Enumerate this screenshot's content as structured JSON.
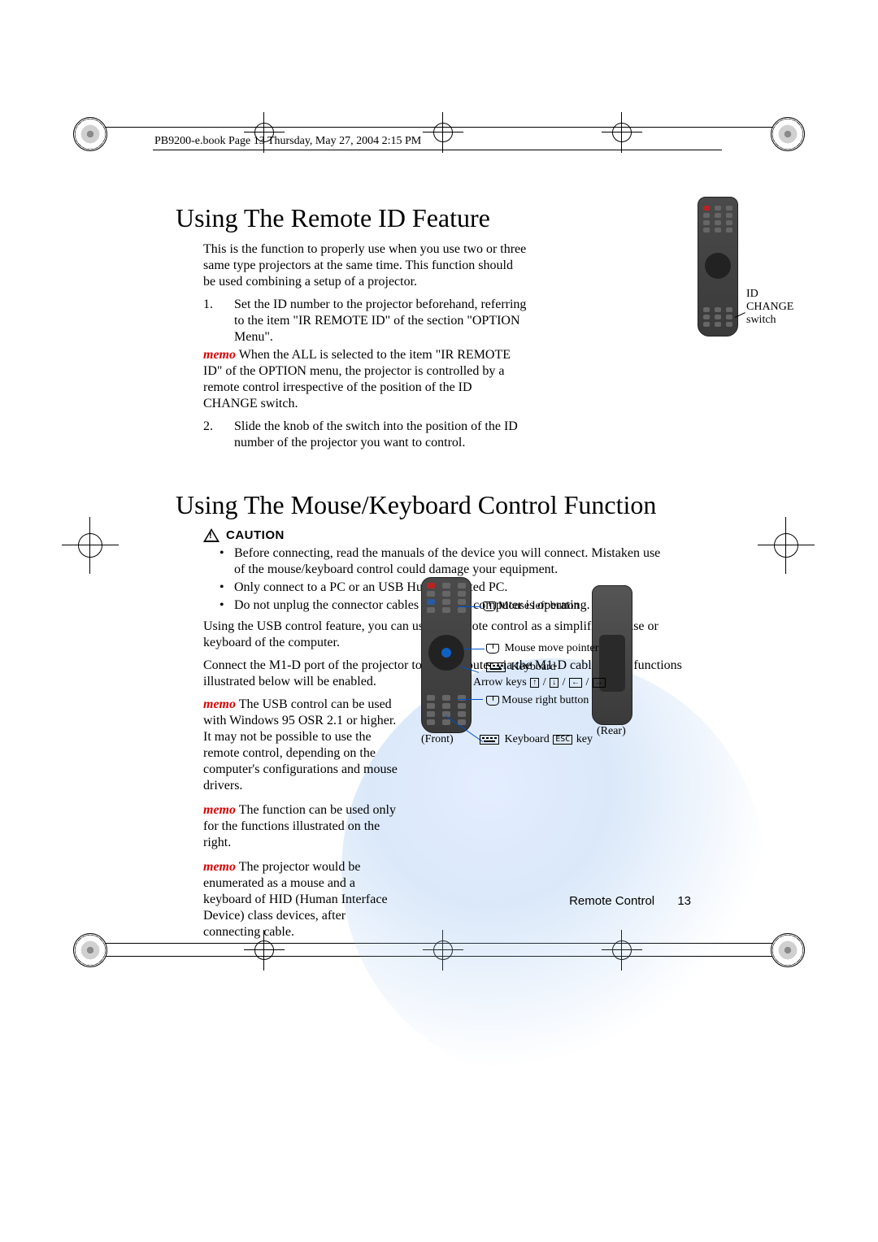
{
  "meta": {
    "bookinfo": "PB9200-e.book  Page 13  Thursday, May 27, 2004  2:15 PM"
  },
  "section1": {
    "title": "Using The Remote ID Feature",
    "intro": "This is the function to properly use when you use two or three same type projectors at the same time. This function should be used combining a setup of a projector.",
    "step1_num": "1.",
    "step1": "Set the ID number to the projector beforehand, referring to the item \"IR REMOTE ID\" of the section \"OPTION Menu\".",
    "memo1_label": "memo",
    "memo1": " When the ALL is selected to the item \"IR REMOTE ID\" of the OPTION menu, the projector is controlled by a remote control irrespective of the position of the ID CHANGE switch.",
    "step2_num": "2.",
    "step2": "Slide the knob of the switch into the position of the ID number of the projector you want to control.",
    "id_label_l1": "ID",
    "id_label_l2": "CHANGE",
    "id_label_l3": "switch"
  },
  "section2": {
    "title": "Using The Mouse/Keyboard Control Function",
    "caution": "CAUTION",
    "bul1": "Before connecting, read the manuals of the device you will connect. Mistaken use of the mouse/keyboard control could damage your equipment.",
    "bul2": "Only connect to a PC or an USB Hub connected PC.",
    "bul3": "Do not unplug the connector cables while the computer is operating.",
    "p1": "Using the USB control feature, you can use the remote control as a simplified mouse or keyboard of the computer.",
    "p2": "Connect the M1-D port of the projector to the computer via the M1-D cable. Then functions illustrated below will be enabled.",
    "memoA_label": "memo",
    "memoA": " The USB control can be used with Windows 95 OSR 2.1 or higher. It may not be possible to use the remote control, depending on the computer's configurations and mouse drivers.",
    "memoB_label": "memo",
    "memoB": " The function can be used only for the functions illustrated on the right.",
    "memoC_label": "memo",
    "memoC": " The projector would be enumerated as a mouse and a keyboard of HID (Human Interface Device) class devices, after connecting cable."
  },
  "diagram": {
    "front": "(Front)",
    "rear": "(Rear)",
    "mouse_left": "Mouse left button",
    "mouse_move": "Mouse move pointer",
    "keyboard": "Keyboard",
    "arrow_keys": "Arrow keys",
    "mouse_right": "Mouse right button",
    "kb_esc1": "Keyboard ",
    "kb_esc2": " key",
    "esc": "ESC",
    "arrow_sym": " / "
  },
  "footer": {
    "section": "Remote Control",
    "page": "13"
  }
}
